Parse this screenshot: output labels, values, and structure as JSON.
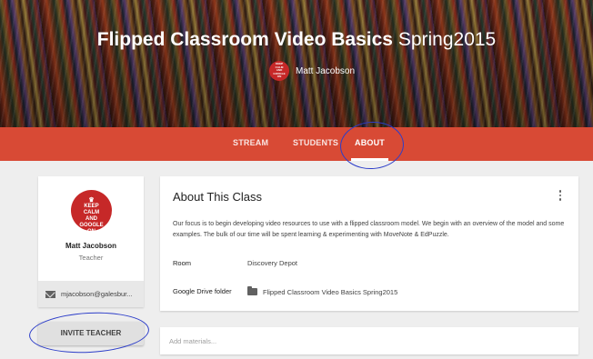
{
  "header": {
    "title_bold": "Flipped Classroom Video Basics",
    "title_light": "Spring2015",
    "owner_name": "Matt Jacobson",
    "owner_avatar_text": "KEEP CALM AND GOOGLE ON"
  },
  "tabs": [
    {
      "label": "STREAM",
      "active": false
    },
    {
      "label": "STUDENTS",
      "active": false
    },
    {
      "label": "ABOUT",
      "active": true
    }
  ],
  "teacher": {
    "avatar_line1": "KEEP",
    "avatar_line2": "CALM",
    "avatar_line3": "AND",
    "avatar_line4": "GOOGLE",
    "avatar_line5": "ON",
    "name": "Matt Jacobson",
    "role": "Teacher",
    "email": "mjacobson@galesbur..."
  },
  "invite_button_label": "INVITE TEACHER",
  "about": {
    "title": "About This Class",
    "description": "Our focus is to begin developing video resources to use with a flipped classroom model. We begin with an overview of the model and some examples. The bulk of our time will be spent learning & experimenting with MoveNote & EdPuzzle.",
    "room_label": "Room",
    "room_value": "Discovery Depot",
    "drive_label": "Google Drive folder",
    "drive_value": "Flipped Classroom Video Basics Spring2015"
  },
  "materials": {
    "placeholder": "Add materials..."
  },
  "colors": {
    "tab_bar": "#d84a35",
    "avatar": "#c62828",
    "annotation": "#2d3ec9",
    "background": "#eeeeee"
  },
  "icons": {
    "menu": "more-vert-icon",
    "email": "mail-icon",
    "folder": "folder-icon"
  }
}
